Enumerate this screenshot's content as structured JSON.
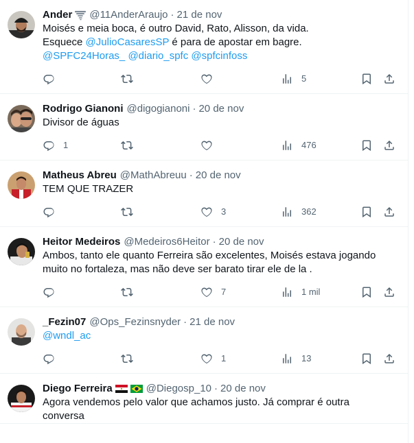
{
  "tweets": [
    {
      "name": "Ander",
      "badge": "tornado-emoji",
      "handle": "@11AnderAraujo",
      "sep": "·",
      "date": "21 de nov",
      "lines": [
        [
          {
            "t": "Moisés e meia boca, é outro David, Rato, Alisson, da vida."
          }
        ],
        [
          {
            "t": "Esquece "
          },
          {
            "t": "@JulioCasaresSP",
            "link": true
          },
          {
            "t": " é para de apostar em bagre."
          }
        ],
        [
          {
            "t": "@SPFC24Horas_",
            "link": true
          },
          {
            "t": " "
          },
          {
            "t": "@diario_spfc",
            "link": true
          },
          {
            "t": " "
          },
          {
            "t": "@spfcinfoss",
            "link": true
          }
        ]
      ],
      "replies": "",
      "retweets": "",
      "likes": "",
      "views": "5"
    },
    {
      "name": "Rodrigo Gianoni",
      "badge": "",
      "handle": "@digogianoni",
      "sep": "·",
      "date": "20 de nov",
      "lines": [
        [
          {
            "t": "Divisor de águas"
          }
        ]
      ],
      "replies": "1",
      "retweets": "",
      "likes": "",
      "views": "476"
    },
    {
      "name": "Matheus Abreu",
      "badge": "",
      "handle": "@MathAbreuu",
      "sep": "·",
      "date": "20 de nov",
      "lines": [
        [
          {
            "t": "TEM QUE TRAZER"
          }
        ]
      ],
      "replies": "",
      "retweets": "",
      "likes": "3",
      "views": "362"
    },
    {
      "name": "Heitor Medeiros",
      "badge": "",
      "handle": "@Medeiros6Heitor",
      "sep": "·",
      "date": "20 de nov",
      "lines": [
        [
          {
            "t": "Ambos, tanto ele quanto Ferreira são excelentes, Moisés estava jogando"
          }
        ],
        [
          {
            "t": "muito no fortaleza, mas não deve ser barato tirar ele de la ."
          }
        ]
      ],
      "replies": "",
      "retweets": "",
      "likes": "7",
      "views": "1 mil"
    },
    {
      "name": "_Fezin07",
      "badge": "",
      "handle": "@Ops_Fezinsnyder",
      "sep": "·",
      "date": "21 de nov",
      "lines": [
        [
          {
            "t": "@wndl_ac",
            "link": true
          }
        ]
      ],
      "replies": "",
      "retweets": "",
      "likes": "1",
      "views": "13"
    },
    {
      "name": "Diego Ferreira",
      "badge": "flags-egypt-brazil",
      "handle": "@Diegosp_10",
      "sep": "·",
      "date": "20 de nov",
      "lines": [
        [
          {
            "t": "Agora vendemos pelo valor que achamos justo. Já comprar é outra"
          }
        ],
        [
          {
            "t": "conversa"
          }
        ]
      ],
      "replies": "",
      "retweets": "",
      "likes": "",
      "views": ""
    }
  ],
  "icons": {
    "more": "more-horizontal-icon",
    "reply": "reply-icon",
    "retweet": "retweet-icon",
    "like": "heart-icon",
    "views": "views-chart-icon",
    "bookmark": "bookmark-icon",
    "share": "share-icon"
  },
  "colors": {
    "text": "#0f1419",
    "muted": "#536471",
    "link": "#1d9bf0",
    "divider": "#eff3f4"
  }
}
